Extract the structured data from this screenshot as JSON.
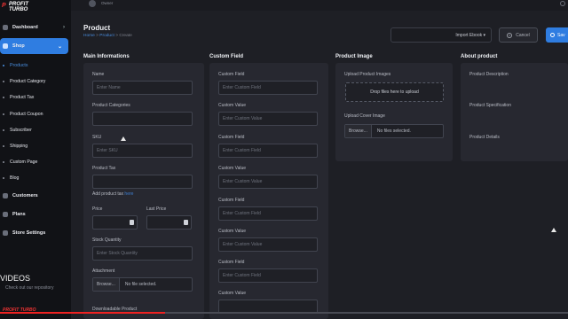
{
  "brand": {
    "mark": "P",
    "line1": "PROFIT",
    "line2": "TURBO"
  },
  "sidebar": {
    "top_items": [
      {
        "label": "Dashboard"
      },
      {
        "label": "Shop"
      }
    ],
    "shop_items": [
      {
        "label": "Products"
      },
      {
        "label": "Product Category"
      },
      {
        "label": "Product Tax"
      },
      {
        "label": "Product Coupon"
      },
      {
        "label": "Subscriber"
      },
      {
        "label": "Shipping"
      },
      {
        "label": "Custom Page"
      },
      {
        "label": "Blog"
      }
    ],
    "bottom_items": [
      {
        "label": "Customers"
      },
      {
        "label": "Plans"
      },
      {
        "label": "Store Settings"
      }
    ],
    "footer_text": "Check out our repository"
  },
  "topbar": {
    "user_name": "Owner"
  },
  "header": {
    "title": "Product",
    "breadcrumb": {
      "home": "Home",
      "sep1": ">",
      "parent": "Product",
      "sep2": ">",
      "current": "Create"
    },
    "import_label": "Import Ebook ▾",
    "cancel_label": "Cancel",
    "save_label": "Sav"
  },
  "main_info": {
    "title": "Main Informations",
    "name_label": "Name",
    "name_placeholder": "Enter Name",
    "categories_label": "Product Categories",
    "sku_label": "SKU",
    "sku_placeholder": "Enter SKU",
    "tax_label": "Product Tax",
    "add_tax_text": "Add product tax",
    "add_tax_link": "here",
    "price_label": "Price",
    "last_price_label": "Last Price",
    "stock_label": "Stock Quantity",
    "stock_placeholder": "Enter Stock Quantity",
    "attachment_label": "Attachment",
    "browse_label": "Browse...",
    "no_file_label": "No file selected.",
    "downloadable_label": "Downloadable Product"
  },
  "custom_field": {
    "title": "Custom Field",
    "rows": [
      {
        "label": "Custom Field",
        "placeholder": "Enter Custom Field"
      },
      {
        "label": "Custom Value",
        "placeholder": "Enter Custom Value"
      },
      {
        "label": "Custom Field",
        "placeholder": "Enter Custom Field"
      },
      {
        "label": "Custom Value",
        "placeholder": "Enter Custom Value"
      },
      {
        "label": "Custom Field",
        "placeholder": "Enter Custom Field"
      },
      {
        "label": "Custom Value",
        "placeholder": "Enter Custom Value"
      },
      {
        "label": "Custom Field",
        "placeholder": "Enter Custom Field"
      },
      {
        "label": "Custom Value",
        "placeholder": ""
      }
    ]
  },
  "product_image": {
    "title": "Product Image",
    "upload_images_label": "Upload Product Images",
    "dropzone_text": "Drop files here to upload",
    "cover_label": "Upload Cover Image",
    "browse_label": "Browse...",
    "no_file_label": "No files selected."
  },
  "about_product": {
    "title": "About product",
    "description_label": "Product Description",
    "specification_label": "Product Specification",
    "details_label": "Product Details"
  },
  "overlay": {
    "videos_label": "VIDEOS",
    "watermark": "PROFIT TURBO"
  },
  "video_progress": {
    "played_fraction": 0.29
  },
  "colors": {
    "accent": "#2f7de1",
    "sidebar_bg": "#111216",
    "page_bg": "#1e1f25",
    "panel_bg": "#272830",
    "progress": "#ee2222"
  }
}
